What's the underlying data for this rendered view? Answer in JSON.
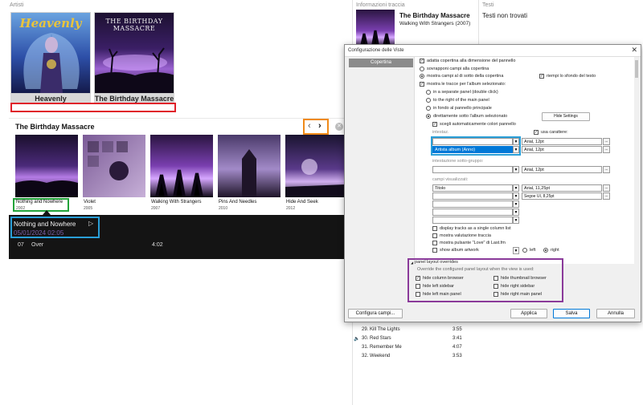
{
  "headers": {
    "artisti": "Artisti",
    "info_traccia": "Informazioni traccia",
    "testi": "Testi"
  },
  "artists": [
    {
      "name": "Heavenly",
      "logo": "Heavenly"
    },
    {
      "name": "The Birthday Massacre",
      "logo": "THE BIRTHDAY MASSACRE"
    }
  ],
  "album_panel": {
    "title": "The Birthday Massacre",
    "albums": [
      {
        "title": "Nothing and Nowhere",
        "year": "2002"
      },
      {
        "title": "Violet",
        "year": "2005"
      },
      {
        "title": "Walking With Strangers",
        "year": "2007"
      },
      {
        "title": "Pins And Needles",
        "year": "2010"
      },
      {
        "title": "Hide And Seek",
        "year": "2012"
      }
    ],
    "player": {
      "album": "Nothing and Nowhere",
      "date": "05/01/2024 02:05",
      "track_no": "07",
      "track_title": "Over",
      "duration": "4:02"
    }
  },
  "track_info": {
    "artist": "The Birthday Massacre",
    "album": "Walking With Strangers (2007)"
  },
  "lyrics": {
    "status": "Testi non trovati"
  },
  "tracklist": [
    {
      "title": "29. Kill The Lights",
      "duration": "3:55"
    },
    {
      "title": "30. Red Stars",
      "duration": "3:41"
    },
    {
      "title": "31. Remember Me",
      "duration": "4:07"
    },
    {
      "title": "32. Weekend",
      "duration": "3:53"
    }
  ],
  "dialog": {
    "title": "Configurazione delle Viste",
    "close": "✕",
    "tab": "Copertina",
    "options": {
      "adatta": "adatta copertina alla dimensione del pannello",
      "sovrapponi": "sovrapponi campi alla copertina",
      "mostra_campi": "mostra campi al di sotto della copertina",
      "riempi": "riempi lo sfondo del testo",
      "mostra_tracce": "mostra le tracce per l'album selezionato:",
      "separate_panel": "in a separate panel (double click)",
      "right_of_main": "to the right of the main panel",
      "in_fondo": "in fondo al pannello principale",
      "direttamente": "direttamente sotto l'album selezionato",
      "hide_settings": "Hide Settings",
      "scegli_colori": "scegli automaticamente colori pannello"
    },
    "intestazione": {
      "label": "intestaz.",
      "usa_carattere": "usa carattere:",
      "row1_font": "Arial, 12pt",
      "row2_field": "Artista album (Anno)",
      "row2_font": "Arial, 12pt"
    },
    "sottogruppo": {
      "label": "intestazione sotto-gruppo:",
      "font": "Arial, 12pt"
    },
    "campi": {
      "label": "campi visualizzati:",
      "field1": "Titolo",
      "font1": "Arial, 11,25pt",
      "font2": "Segoe UI, 8,25pt"
    },
    "more": {
      "single_column": "display tracks as a single column list",
      "valutazione": "mostra valutazione traccia",
      "love": "mostra pulsante \"Love\" di Last.fm",
      "show_artwork": "show album artwork",
      "left": "left",
      "right": "right"
    },
    "overrides": {
      "title": "panel layout overrides",
      "desc": "Override the configured panel layout when the view is used:",
      "hide_column_browser": "hide column browser",
      "hide_thumbnail_browser": "hide thumbnail browser",
      "hide_left_sidebar": "hide left sidebar",
      "hide_right_sidebar": "hide right sidebar",
      "hide_left_main": "hide left main panel",
      "hide_right_main": "hide right main panel"
    },
    "buttons": {
      "configura": "Configura campi...",
      "applica": "Applica",
      "salva": "Salva",
      "annulla": "Annulla"
    }
  },
  "colors": {
    "highlight_red": "#e0202a",
    "highlight_orange": "#f08a18",
    "highlight_green": "#23a33a",
    "highlight_blue": "#2a9fd8",
    "highlight_purple": "#8a3a9a",
    "selection_blue": "#0078d7"
  }
}
